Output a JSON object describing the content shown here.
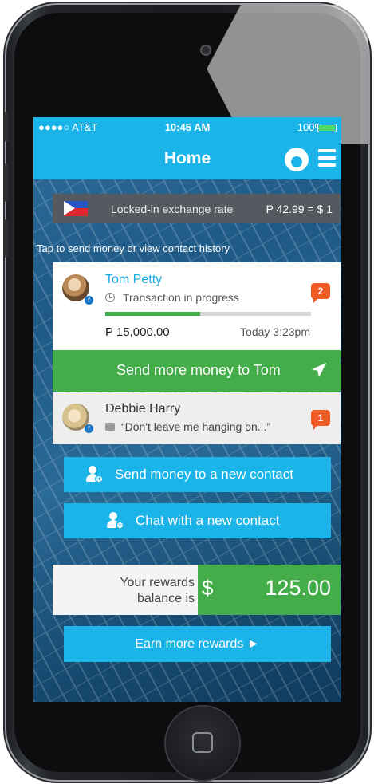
{
  "status_bar": {
    "carrier": "●●●●○ AT&T",
    "time": "10:45 AM",
    "battery": "100%"
  },
  "nav": {
    "title": "Home"
  },
  "exchange": {
    "label": "Locked-in exchange rate",
    "value": "P 42.99 = $ 1"
  },
  "hint": "Tap to send money or view contact history",
  "contacts": [
    {
      "name": "Tom Petty",
      "status": "Transaction in progress",
      "amount": "P 15,000.00",
      "time": "Today 3:23pm",
      "badge": "2",
      "progress": 0.46
    },
    {
      "name": "Debbie Harry",
      "message": "“Don't leave me hanging on...”",
      "badge": "1"
    }
  ],
  "actions": {
    "send_more": "Send more money to Tom",
    "send_new": "Send money to a new contact",
    "chat_new": "Chat with a new contact",
    "earn": "Earn more rewards ►"
  },
  "rewards": {
    "label_line1": "Your rewards",
    "label_line2": "balance is",
    "currency": "$",
    "amount": "125.00"
  },
  "colors": {
    "primary": "#1bb4e8",
    "green": "#44ad4a",
    "badge": "#ef5b25"
  }
}
